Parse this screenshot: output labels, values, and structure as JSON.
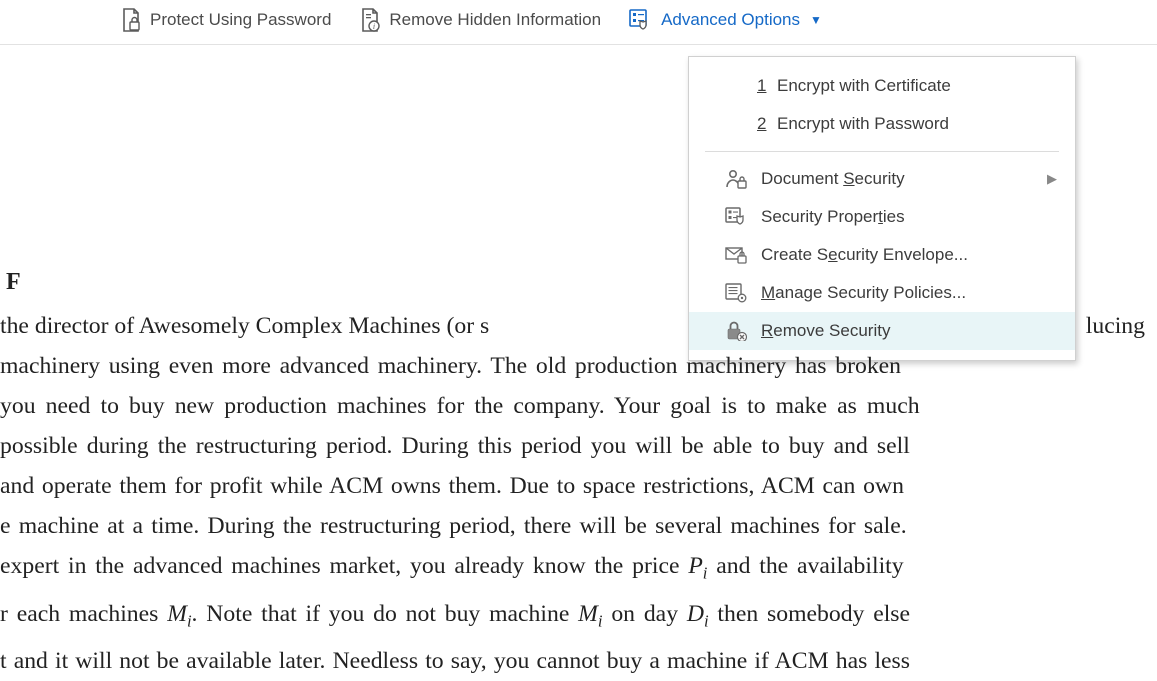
{
  "toolbar": {
    "protect_label": "Protect Using Password",
    "remove_label": "Remove Hidden Information",
    "advanced_label": "Advanced Options"
  },
  "menu": {
    "encrypt_cert_num": "1",
    "encrypt_cert_label": "Encrypt with Certificate",
    "encrypt_pass_num": "2",
    "encrypt_pass_label": "Encrypt with Password",
    "doc_security_label": "Document Security",
    "sec_props_label": "Security Properties",
    "create_env_label": "Create Security Envelope...",
    "manage_pol_label": "Manage Security Policies...",
    "remove_sec_label": "Remove Security"
  },
  "doc": {
    "heading": "F",
    "l1a": "the  director  of  Awesomely  Complex  Machines  (or  s",
    "l1b": "lucing",
    "l2": "machinery using even more advanced machinery. The old production machinery has broken",
    "l3": "you need to buy new production machines for the company. Your goal is to make as much",
    "l4": "possible during the restructuring period. During this period you will be able to buy and sell",
    "l5": "and operate them for profit while ACM owns them. Due to space restrictions, ACM can own",
    "l6": "e machine at a time. During the restructuring period, there will be several machines for sale.",
    "l7a": "expert in the advanced machines market, you already know the price ",
    "l7b": " and the availability",
    "l8a": "r each machines ",
    "l8b": ". Note that if you do not buy machine ",
    "l8c": " on day ",
    "l8d": " then somebody else",
    "l9": "t and it will not be available later. Needless to say, you cannot buy a machine if ACM has less"
  }
}
